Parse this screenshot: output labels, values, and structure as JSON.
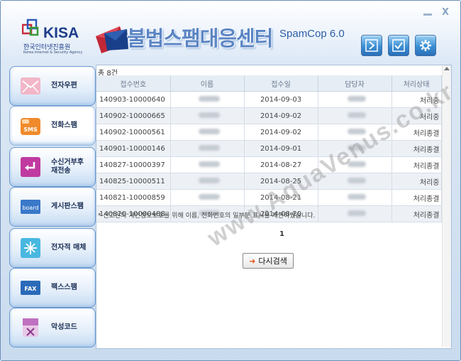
{
  "window": {
    "minimize_label": "",
    "close_label": "X"
  },
  "logo": {
    "name": "KISA",
    "korean": "한국인터넷진흥원",
    "english": "Korea Internet & Security Agency"
  },
  "app": {
    "title": "불법스팸대응센터",
    "subtitle": "SpamCop 6.0"
  },
  "toolbar": {
    "buttons": [
      {
        "icon": "arrow-right-icon"
      },
      {
        "icon": "checkmark-icon"
      },
      {
        "icon": "gear-icon"
      }
    ]
  },
  "sidebar": {
    "items": [
      {
        "label": "전자우편",
        "icon": "email-icon",
        "color": "#e07aa0"
      },
      {
        "label": "전화스팸",
        "icon": "sms-icon",
        "color": "#f08a2a",
        "icon_text": "SMS"
      },
      {
        "label": "수신거부후\n재전송",
        "icon": "redirect-icon",
        "color": "#c03aa0"
      },
      {
        "label": "게시판스팸",
        "icon": "board-icon",
        "color": "#3a78c8",
        "icon_text": "board"
      },
      {
        "label": "전자적 매체",
        "icon": "sparkle-icon",
        "color": "#2ab0d8"
      },
      {
        "label": "팩스스팸",
        "icon": "fax-icon",
        "color": "#2a6ab8",
        "icon_text": "FAX"
      },
      {
        "label": "악성코드",
        "icon": "malware-icon",
        "color": "#c070c0"
      }
    ]
  },
  "results": {
    "count_text": "총 8건",
    "columns": [
      "접수번호",
      "이름",
      "접수일",
      "담당자",
      "처리상태"
    ],
    "rows": [
      {
        "id": "140903-10000640",
        "date": "2014-09-03",
        "status": "처리중"
      },
      {
        "id": "140902-10000665",
        "date": "2014-09-02",
        "status": "처리중"
      },
      {
        "id": "140902-10000561",
        "date": "2014-09-02",
        "status": "처리종결"
      },
      {
        "id": "140901-10000146",
        "date": "2014-09-01",
        "status": "처리종결"
      },
      {
        "id": "140827-10000397",
        "date": "2014-08-27",
        "status": "처리종결"
      },
      {
        "id": "140825-10000511",
        "date": "2014-08-25",
        "status": "처리중"
      },
      {
        "id": "140821-10000859",
        "date": "2014-08-21",
        "status": "처리종결"
      },
      {
        "id": "140820-10000488",
        "date": "2014-08-20",
        "status": "처리종결"
      }
    ],
    "notice": "* 신고인의 개인정보보호를 위해 이름, 전화번호의 일부분 표시를 제한하였습니다.",
    "page": "1",
    "research_button": "다시검색"
  },
  "watermark": "www.AquaVenus.co.kr"
}
